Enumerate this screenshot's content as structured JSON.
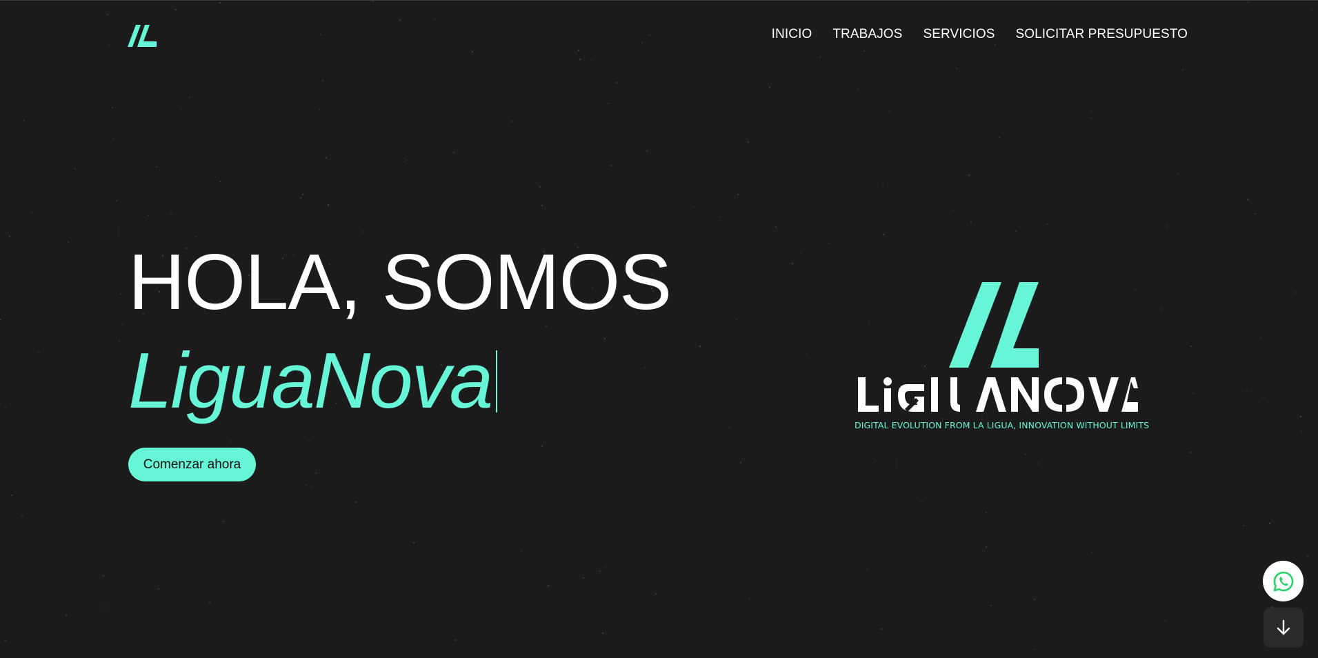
{
  "brand": {
    "name": "LiguaNova",
    "wordmark": "LIGUANOVA",
    "tagline": "DIGITAL EVOLUTION FROM LA LIGUA, INNOVATION WITHOUT LIMITS"
  },
  "nav": {
    "items": [
      {
        "label": "INICIO"
      },
      {
        "label": "TRABAJOS"
      },
      {
        "label": "SERVICIOS"
      },
      {
        "label": "SOLICITAR PRESUPUESTO"
      }
    ]
  },
  "hero": {
    "line1": "HOLA, SOMOS",
    "line2": "LiguaNova",
    "cta_label": "Comenzar ahora"
  },
  "floating": {
    "whatsapp_icon": "whatsapp-icon",
    "scroll_icon": "arrow-down-icon"
  },
  "colors": {
    "background": "#1b1b1b",
    "accent": "#66f5d6",
    "text": "#ffffff",
    "whatsapp_green": "#25d366"
  }
}
